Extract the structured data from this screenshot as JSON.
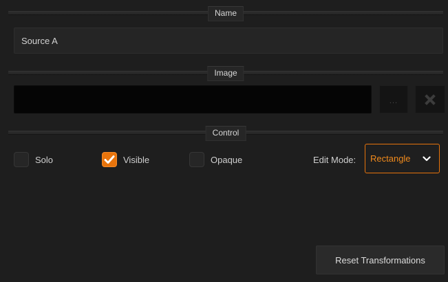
{
  "sections": {
    "name": "Name",
    "image": "Image",
    "control": "Control"
  },
  "name_field": {
    "value": "Source A"
  },
  "image": {
    "path_value": "",
    "browse_label": "...",
    "clear_icon": "close-icon"
  },
  "control": {
    "options": [
      {
        "label": "Solo",
        "checked": false
      },
      {
        "label": "Visible",
        "checked": true
      },
      {
        "label": "Opaque",
        "checked": false
      }
    ],
    "edit_mode_label": "Edit Mode:",
    "edit_mode_value": "Rectangle"
  },
  "reset_label": "Reset Transformations",
  "colors": {
    "accent": "#e8740c",
    "background": "#1e1e1e",
    "text": "#cfcfcf"
  }
}
